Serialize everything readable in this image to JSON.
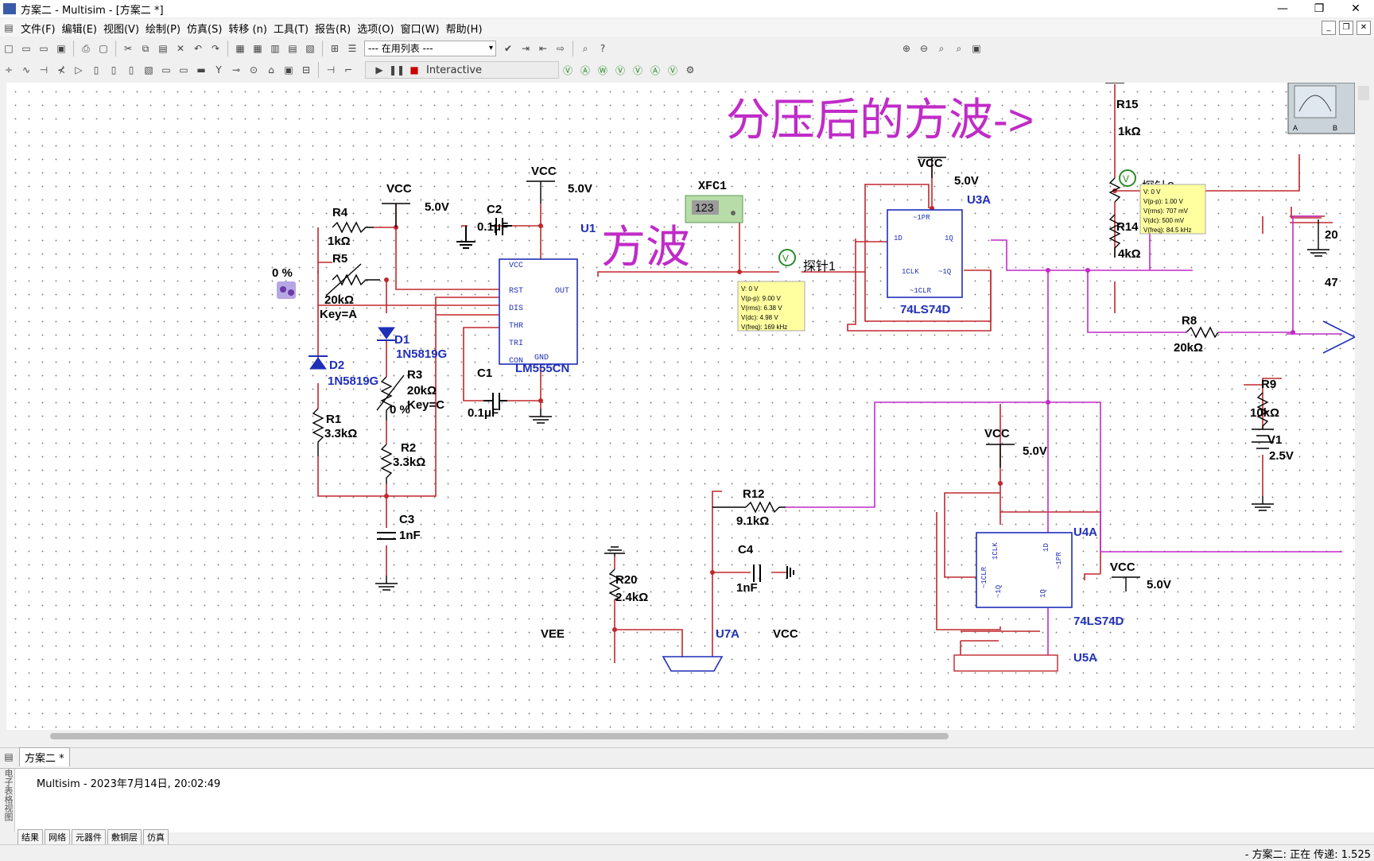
{
  "window": {
    "title": "方案二 - Multisim - [方案二 *]",
    "min": "—",
    "max": "❐",
    "close": "✕"
  },
  "menu": [
    "文件(F)",
    "编辑(E)",
    "视图(V)",
    "绘制(P)",
    "仿真(S)",
    "转移 (n)",
    "工具(T)",
    "报告(R)",
    "选项(O)",
    "窗口(W)",
    "帮助(H)"
  ],
  "toolbar": {
    "in_use_list": "--- 在用列表 ---",
    "sim_mode": "Interactive"
  },
  "schematic": {
    "annotation_top": "分压后的方波->",
    "annotation_square": "方波",
    "probe1": {
      "label": "探针1",
      "v": "V: 0 V",
      "vpp": "V(p-p): 9.00 V",
      "vrms": "V(rms): 6.38 V",
      "vdc": "V(dc): 4.98 V",
      "freq": "V(freq): 169 kHz"
    },
    "probe2": {
      "label": "探针2",
      "v": "V: 0 V",
      "vpp": "V(p-p): 1.00 V",
      "vrms": "V(rms): 707 mV",
      "vdc": "V(dc): 500 mV",
      "freq": "V(freq): 84.5 kHz"
    },
    "xfc1": {
      "name": "XFC1",
      "display": "123"
    },
    "components": {
      "vcc_label": "VCC",
      "vee_label": "VEE",
      "supply": "5.0V",
      "r4": "R4",
      "r4v": "1kΩ",
      "r5": "R5",
      "r5v": "20kΩ",
      "r5key": "Key=A",
      "r5pct": "0 %",
      "d1": "D1",
      "d1v": "1N5819G",
      "d2": "D2",
      "d2v": "1N5819G",
      "r3": "R3",
      "r3v": "20kΩ",
      "r3key": "Key=C",
      "r3pct": "0 %",
      "r1": "R1",
      "r1v": "3.3kΩ",
      "r2": "R2",
      "r2v": "3.3kΩ",
      "c3": "C3",
      "c3v": "1nF",
      "c2": "C2",
      "c2v": "0.1μF",
      "c1": "C1",
      "c1v": "0.1μF",
      "u1": "U1",
      "u1v": "LM555CN",
      "u3a": "U3A",
      "u3v": "74LS74D",
      "u4a": "U4A",
      "u4v": "74LS74D",
      "u5a": "U5A",
      "r15": "R15",
      "r15v": "1kΩ",
      "r14": "R14",
      "r14v": "4kΩ",
      "r8": "R8",
      "r8v": "20kΩ",
      "r9": "R9",
      "r9v": "10kΩ",
      "v1": "V1",
      "v1v": "2.5V",
      "r12": "R12",
      "r12v": "9.1kΩ",
      "c4": "C4",
      "c4v": "1nF",
      "r20": "R20",
      "r20v": "2.4kΩ",
      "u7a": "U7A",
      "r_partial1": "20",
      "r_partial2": "47",
      "pin_rst": "RST",
      "pin_dis": "DIS",
      "pin_thr": "THR",
      "pin_tri": "TRI",
      "pin_con": "CON",
      "pin_gnd": "GND",
      "pin_vcc": "VCC",
      "pin_out": "OUT",
      "ff_1pr": "~1PR",
      "ff_1d": "1D",
      "ff_1q": "1Q",
      "ff_1clk": "1CLK",
      "ff_n1q": "~1Q",
      "ff_1clr": "~1CLR"
    }
  },
  "doc_tab": "方案二 *",
  "output": {
    "log": "Multisim  -  2023年7月14日, 20:02:49",
    "side_title": "电子表格视图",
    "tabs": [
      "结果",
      "网络",
      "元器件",
      "敷铜层",
      "仿真"
    ]
  },
  "status": "-    方案二: 正在 传递: 1.525"
}
